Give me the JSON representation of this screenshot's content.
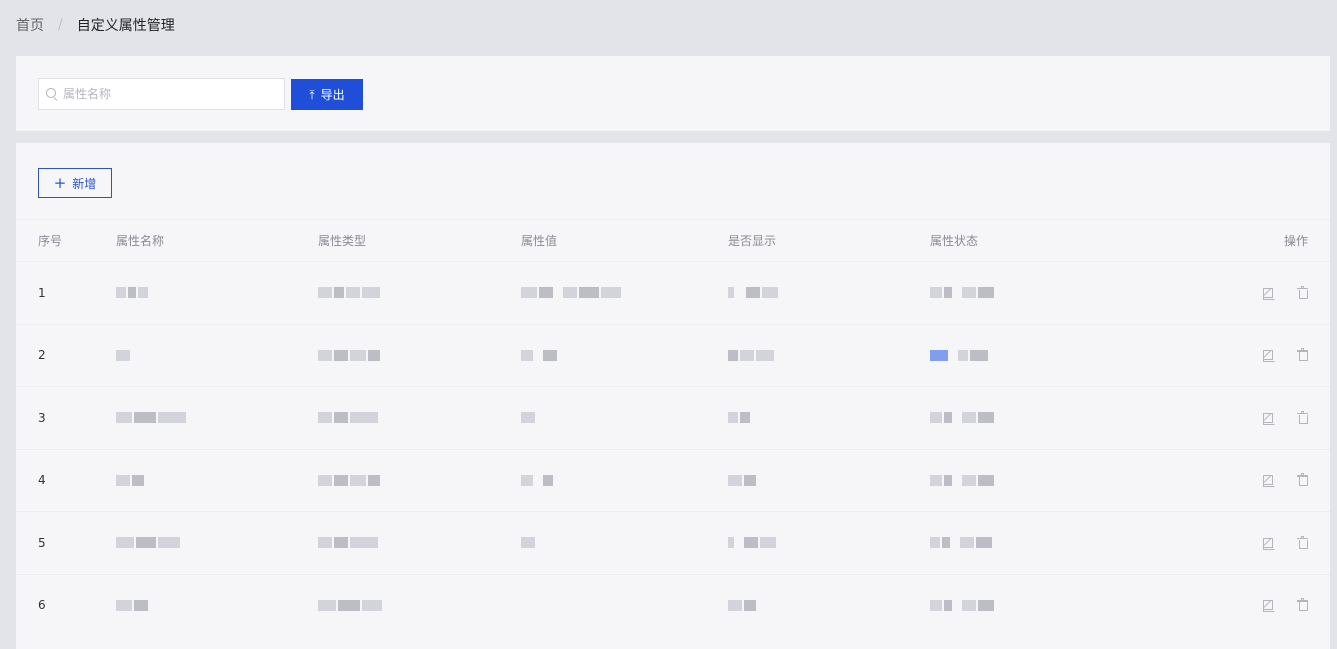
{
  "breadcrumb": {
    "home": "首页",
    "separator": "/",
    "current": "自定义属性管理"
  },
  "search": {
    "placeholder": "属性名称",
    "value": ""
  },
  "toolbar": {
    "export_label": "导出",
    "add_label": "新增"
  },
  "table": {
    "headers": {
      "index": "序号",
      "name": "属性名称",
      "type": "属性类型",
      "value": "属性值",
      "display": "是否显示",
      "status": "属性状态",
      "actions": "操作"
    },
    "rows": [
      {
        "index": "1"
      },
      {
        "index": "2"
      },
      {
        "index": "3"
      },
      {
        "index": "4"
      },
      {
        "index": "5"
      },
      {
        "index": "6"
      }
    ]
  },
  "colors": {
    "primary": "#1f4fd8",
    "page_bg": "#e3e3ea",
    "panel_bg": "#f6f6f9"
  }
}
